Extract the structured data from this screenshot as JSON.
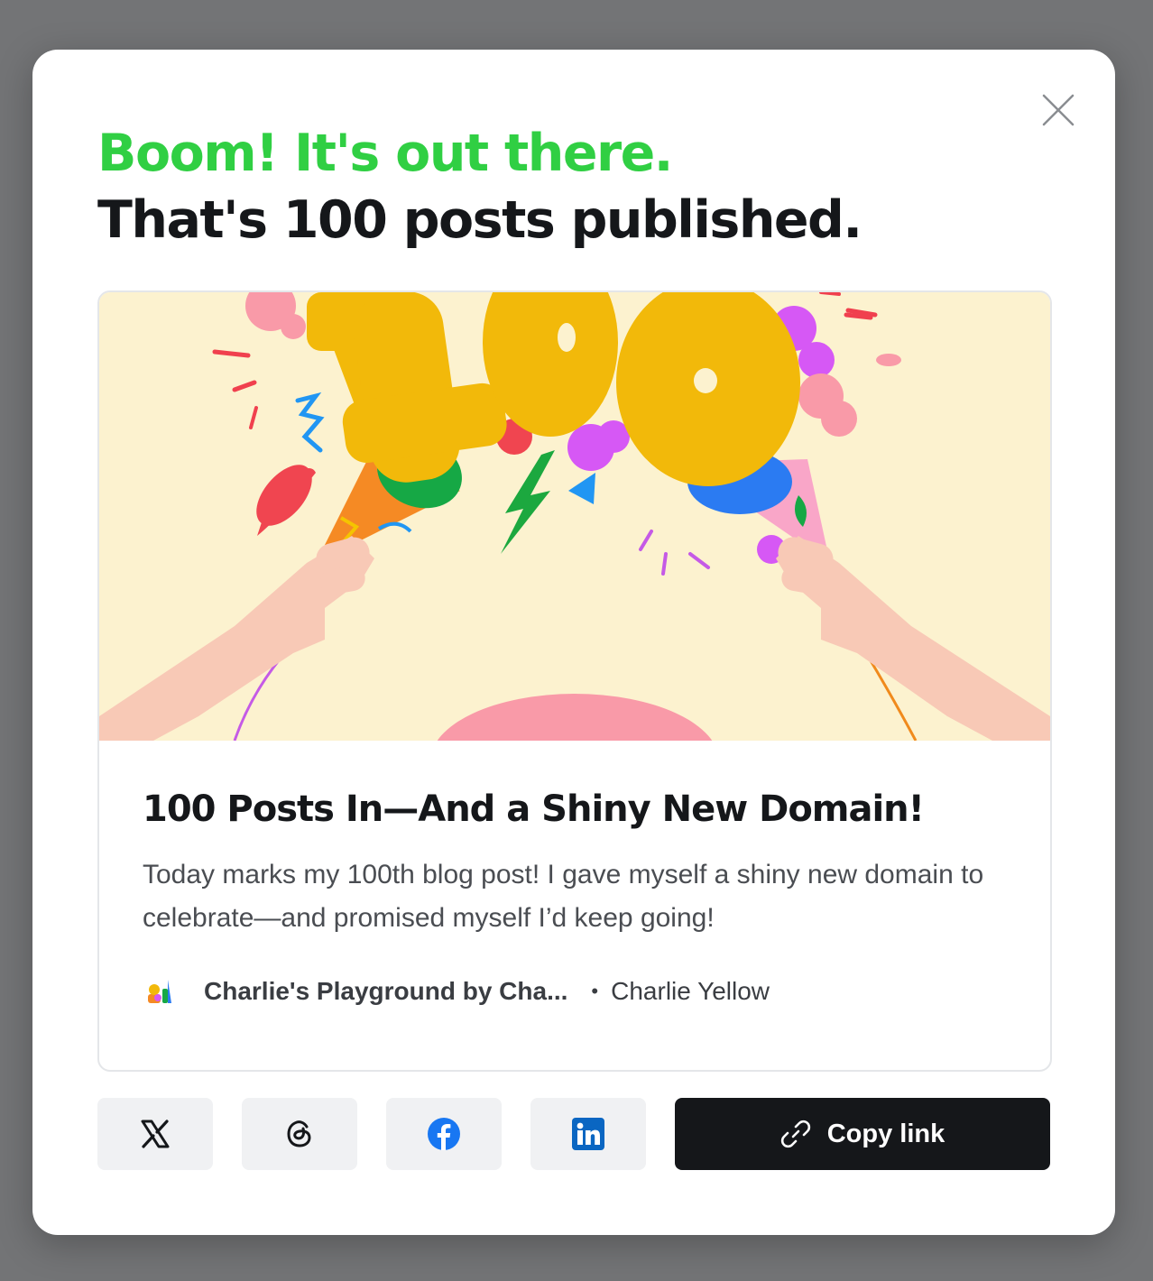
{
  "modal": {
    "headline_line1": "Boom! It's out there.",
    "headline_line2": "That's 100 posts published.",
    "close_icon": "close-icon"
  },
  "post": {
    "image_icon": "celebration-100-illustration",
    "title": "100 Posts In—And a Shiny New Domain!",
    "excerpt": "Today marks my 100th blog post! I gave myself a shiny new domain to celebrate—and promised myself I’d keep going!",
    "publication": "Charlie's Playground by Cha...",
    "separator": "•",
    "author": "Charlie Yellow"
  },
  "share": {
    "buttons": [
      {
        "icon": "x-icon"
      },
      {
        "icon": "threads-icon"
      },
      {
        "icon": "facebook-icon"
      },
      {
        "icon": "linkedin-icon"
      }
    ],
    "copy_label": "Copy link"
  },
  "colors": {
    "accent_green": "#30cf43",
    "text_dark": "#15171a",
    "facebook_blue": "#1877f2",
    "linkedin_blue": "#0a66c2"
  }
}
